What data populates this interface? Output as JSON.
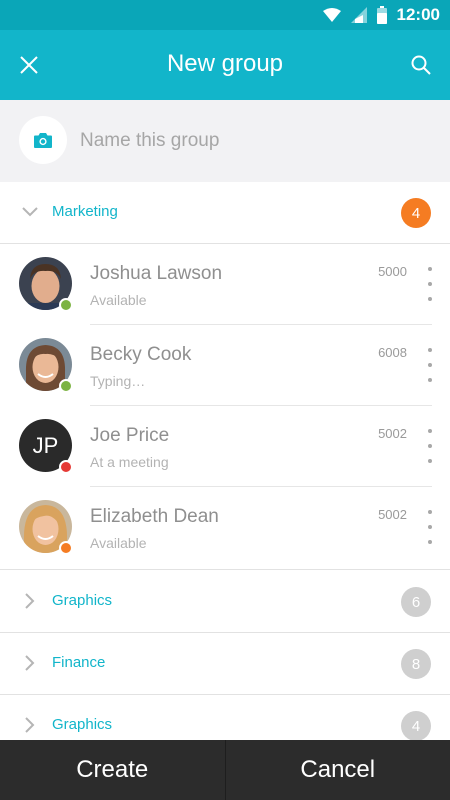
{
  "status_bar": {
    "time": "12:00"
  },
  "app_bar": {
    "title": "New group"
  },
  "name_field": {
    "placeholder": "Name this group",
    "value": ""
  },
  "groups": [
    {
      "name": "Marketing",
      "count": "4",
      "expanded": true,
      "contacts": [
        {
          "name": "Joshua Lawson",
          "status": "Available",
          "ext": "5000",
          "presence": "#7cb342",
          "initials": ""
        },
        {
          "name": "Becky Cook",
          "status": "Typing…",
          "ext": "6008",
          "presence": "#7cb342",
          "initials": ""
        },
        {
          "name": "Joe Price",
          "status": "At a meeting",
          "ext": "5002",
          "presence": "#e53935",
          "initials": "JP"
        },
        {
          "name": "Elizabeth Dean",
          "status": "Available",
          "ext": "5002",
          "presence": "#f57c22",
          "initials": ""
        }
      ]
    },
    {
      "name": "Graphics",
      "count": "6",
      "expanded": false
    },
    {
      "name": "Finance",
      "count": "8",
      "expanded": false
    },
    {
      "name": "Graphics",
      "count": "4",
      "expanded": false
    }
  ],
  "actions": {
    "create": "Create",
    "cancel": "Cancel"
  },
  "colors": {
    "accent": "#12b5ca",
    "badge_active": "#f57c22",
    "bottom_bar": "#2c2c2c"
  }
}
